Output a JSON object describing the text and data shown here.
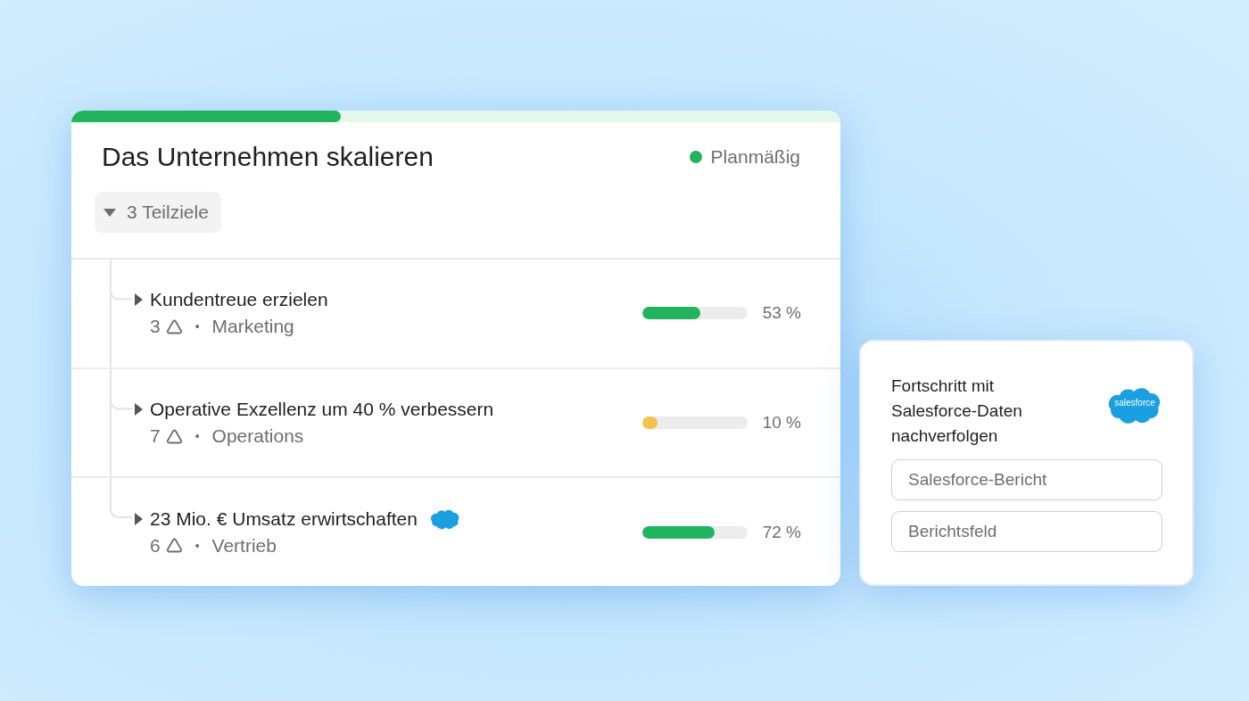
{
  "goal_card": {
    "progress": {
      "level": 0.35
    },
    "title": "Das Unternehmen skalieren",
    "status": {
      "label": "Planmäßig",
      "color": "#22b35e"
    },
    "subgoals_toggle": {
      "label": "3 Teilziele",
      "expanded": true
    },
    "subgoals": [
      {
        "title": "Kundentreue erzielen",
        "expanded": false,
        "salesforce": false,
        "count": "3",
        "separator": "•",
        "team": "Marketing",
        "level": 0.55,
        "color": "#22b35e",
        "percent": "53 %"
      },
      {
        "title": "Operative Exzellenz um 40 % verbessern",
        "expanded": false,
        "salesforce": false,
        "count": "7",
        "separator": "•",
        "team": "Operations",
        "level": 0.14,
        "color": "#f8c14f",
        "percent": "10 %"
      },
      {
        "title": "23 Mio. € Umsatz erwirtschaften",
        "expanded": false,
        "salesforce": true,
        "count": "6",
        "separator": "•",
        "team": "Vertrieb",
        "level": 0.69,
        "color": "#22b35e",
        "percent": "72 %"
      }
    ]
  },
  "salesforce_card": {
    "heading": "Fortschritt mit Salesforce-Daten nachverfolgen",
    "logo_text": "salesforce",
    "fields": [
      {
        "placeholder": "Salesforce-Bericht"
      },
      {
        "placeholder": "Berichtsfeld"
      }
    ]
  }
}
